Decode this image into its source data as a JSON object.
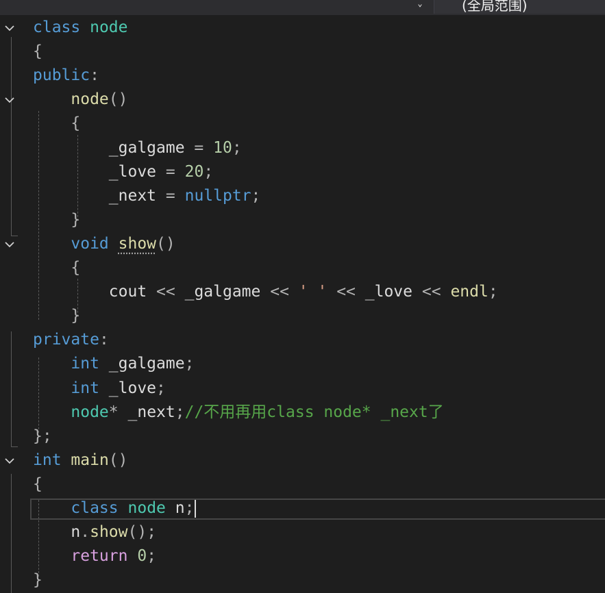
{
  "topbar": {
    "dropdown_arrow": "⌄",
    "scope_label": "(全局范围)"
  },
  "editor": {
    "lines": [
      [
        {
          "t": "class",
          "c": "kw"
        },
        {
          "t": " "
        },
        {
          "t": "node",
          "c": "type"
        }
      ],
      [
        {
          "t": "{",
          "c": "pun"
        }
      ],
      [
        {
          "t": "public",
          "c": "kw"
        },
        {
          "t": ":",
          "c": "pun"
        }
      ],
      [
        {
          "t": "    "
        },
        {
          "t": "node",
          "c": "fn"
        },
        {
          "t": "()",
          "c": "pun"
        }
      ],
      [
        {
          "t": "    "
        },
        {
          "t": "{",
          "c": "pun"
        }
      ],
      [
        {
          "t": "        "
        },
        {
          "t": "_galgame",
          "c": "var"
        },
        {
          "t": " "
        },
        {
          "t": "=",
          "c": "pun"
        },
        {
          "t": " "
        },
        {
          "t": "10",
          "c": "num"
        },
        {
          "t": ";",
          "c": "pun"
        }
      ],
      [
        {
          "t": "        "
        },
        {
          "t": "_love",
          "c": "var"
        },
        {
          "t": " "
        },
        {
          "t": "=",
          "c": "pun"
        },
        {
          "t": " "
        },
        {
          "t": "20",
          "c": "num"
        },
        {
          "t": ";",
          "c": "pun"
        }
      ],
      [
        {
          "t": "        "
        },
        {
          "t": "_next",
          "c": "var"
        },
        {
          "t": " "
        },
        {
          "t": "=",
          "c": "pun"
        },
        {
          "t": " "
        },
        {
          "t": "nullptr",
          "c": "kw"
        },
        {
          "t": ";",
          "c": "pun"
        }
      ],
      [
        {
          "t": "    "
        },
        {
          "t": "}",
          "c": "pun"
        }
      ],
      [
        {
          "t": "    "
        },
        {
          "t": "void",
          "c": "kw"
        },
        {
          "t": " "
        },
        {
          "t": "show",
          "c": "fn squiggle"
        },
        {
          "t": "()",
          "c": "pun"
        }
      ],
      [
        {
          "t": "    "
        },
        {
          "t": "{",
          "c": "pun"
        }
      ],
      [
        {
          "t": "        "
        },
        {
          "t": "cout",
          "c": "var"
        },
        {
          "t": " "
        },
        {
          "t": "<<",
          "c": "pun"
        },
        {
          "t": " "
        },
        {
          "t": "_galgame",
          "c": "var"
        },
        {
          "t": " "
        },
        {
          "t": "<<",
          "c": "pun"
        },
        {
          "t": " "
        },
        {
          "t": "' '",
          "c": "ch"
        },
        {
          "t": " "
        },
        {
          "t": "<<",
          "c": "pun"
        },
        {
          "t": " "
        },
        {
          "t": "_love",
          "c": "var"
        },
        {
          "t": " "
        },
        {
          "t": "<<",
          "c": "pun"
        },
        {
          "t": " "
        },
        {
          "t": "endl",
          "c": "fn"
        },
        {
          "t": ";",
          "c": "pun"
        }
      ],
      [
        {
          "t": "    "
        },
        {
          "t": "}",
          "c": "pun"
        }
      ],
      [
        {
          "t": "private",
          "c": "kw"
        },
        {
          "t": ":",
          "c": "pun"
        }
      ],
      [
        {
          "t": "    "
        },
        {
          "t": "int",
          "c": "kw"
        },
        {
          "t": " "
        },
        {
          "t": "_galgame",
          "c": "var"
        },
        {
          "t": ";",
          "c": "pun"
        }
      ],
      [
        {
          "t": "    "
        },
        {
          "t": "int",
          "c": "kw"
        },
        {
          "t": " "
        },
        {
          "t": "_love",
          "c": "var"
        },
        {
          "t": ";",
          "c": "pun"
        }
      ],
      [
        {
          "t": "    "
        },
        {
          "t": "node",
          "c": "type"
        },
        {
          "t": "*",
          "c": "pun"
        },
        {
          "t": " "
        },
        {
          "t": "_next",
          "c": "var"
        },
        {
          "t": ";",
          "c": "pun"
        },
        {
          "t": "//不用再用class node* _next了",
          "c": "cmt"
        }
      ],
      [
        {
          "t": "};",
          "c": "pun"
        }
      ],
      [
        {
          "t": "int",
          "c": "kw"
        },
        {
          "t": " "
        },
        {
          "t": "main",
          "c": "fn"
        },
        {
          "t": "()",
          "c": "pun"
        }
      ],
      [
        {
          "t": "{",
          "c": "pun"
        }
      ],
      [
        {
          "t": "    "
        },
        {
          "t": "class",
          "c": "kw"
        },
        {
          "t": " "
        },
        {
          "t": "node",
          "c": "type"
        },
        {
          "t": " "
        },
        {
          "t": "n",
          "c": "var"
        },
        {
          "t": ";",
          "c": "pun"
        }
      ],
      [
        {
          "t": "    "
        },
        {
          "t": "n",
          "c": "var"
        },
        {
          "t": ".",
          "c": "pun"
        },
        {
          "t": "show",
          "c": "fn"
        },
        {
          "t": "();",
          "c": "pun"
        }
      ],
      [
        {
          "t": "    "
        },
        {
          "t": "return",
          "c": "ctl"
        },
        {
          "t": " "
        },
        {
          "t": "0",
          "c": "num"
        },
        {
          "t": ";",
          "c": "pun"
        }
      ],
      [
        {
          "t": "}",
          "c": "pun"
        }
      ]
    ],
    "collapse_markers_on_lines": [
      1,
      4,
      10,
      19
    ],
    "current_line": 21,
    "squiggle_word": "show"
  }
}
